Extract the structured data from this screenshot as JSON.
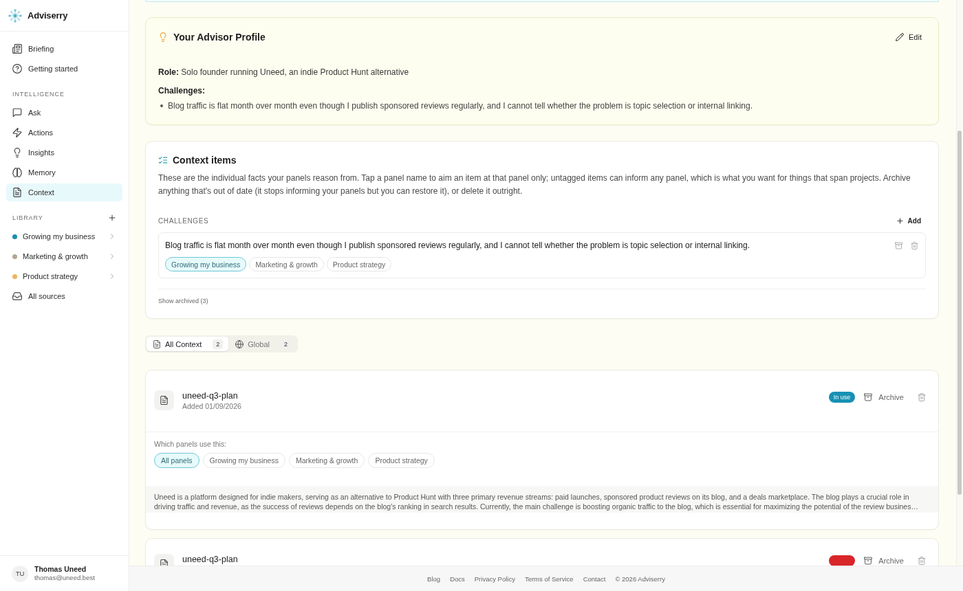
{
  "sidebar": {
    "brand": "Adviserry",
    "items": [
      {
        "kind": "page",
        "label": "Briefing",
        "selected": false
      },
      {
        "kind": "page",
        "label": "Getting started",
        "selected": false
      }
    ],
    "sections": [
      {
        "title": "INTELLIGENCE",
        "can_add": false,
        "items": [
          {
            "kind": "page",
            "label": "Ask",
            "selected": false
          },
          {
            "kind": "page",
            "label": "Actions",
            "selected": false
          },
          {
            "kind": "page",
            "label": "Insights",
            "selected": false
          },
          {
            "kind": "page",
            "label": "Memory",
            "selected": false
          },
          {
            "kind": "page",
            "label": "Context",
            "selected": true
          }
        ]
      },
      {
        "title": "LIBRARY",
        "can_add": true,
        "items": [
          {
            "kind": "panel",
            "label": "Growing my business",
            "color": "#1b8db0",
            "selected": false
          },
          {
            "kind": "panel",
            "label": "Marketing & growth",
            "color": "#b3a690",
            "selected": false
          },
          {
            "kind": "panel",
            "label": "Product strategy",
            "color": "#f2b15f",
            "selected": false
          },
          {
            "kind": "page",
            "label": "All sources",
            "selected": false
          }
        ]
      }
    ],
    "user": {
      "initials": "TU",
      "name": "Thomas Uneed",
      "email": "thomas@uneed.best"
    }
  },
  "profile": {
    "title": "Your Advisor Profile",
    "edit": "Edit",
    "role": "**Role:** Solo founder running Uneed, an indie Product Hunt alternative",
    "challenges_heading": "Challenges:",
    "challenges": [
      "Blog traffic is flat month over month even though I publish sponsored reviews regularly, and I cannot tell whether the problem is topic selection or internal linking."
    ]
  },
  "context_items": {
    "title": "Context items",
    "description": "These are the individual facts your panels reason from. Tap a panel name to aim an item at that panel only; untagged items can inform any panel, which is what you want for things that span projects. Archive anything that's out of date (it stops informing your panels but you can restore it), or delete it outright.",
    "groups": [
      {
        "title": "CHALLENGES",
        "add": "Add",
        "items": [
          {
            "text": "Blog traffic is flat month over month even though I publish sponsored reviews regularly, and I cannot tell whether the problem is topic selection or internal linking.",
            "tags": [
              {
                "label": "Growing my business",
                "selected": true
              },
              {
                "label": "Marketing & growth",
                "selected": false
              },
              {
                "label": "Product strategy",
                "selected": false
              }
            ]
          }
        ]
      }
    ],
    "show_archived": "Show archived (3)"
  },
  "tabs": [
    {
      "label": "All Context",
      "count": "2",
      "selected": true
    },
    {
      "label": "Global",
      "count": "2",
      "selected": false
    }
  ],
  "documents": [
    {
      "title": "uneed-q3-plan",
      "added": "Added 01/09/2026",
      "status": {
        "label": "In use",
        "color": "#1791b3"
      },
      "archive": "Archive",
      "panels_label": "Which panels use this:",
      "panels": [
        {
          "label": "All panels",
          "selected": true
        },
        {
          "label": "Growing my business",
          "selected": false
        },
        {
          "label": "Marketing & growth",
          "selected": false
        },
        {
          "label": "Product strategy",
          "selected": false
        }
      ],
      "summary": "Uneed is a platform designed for indie makers, serving as an alternative to Product Hunt with three primary revenue streams: paid launches, sponsored product reviews on its blog, and a deals marketplace. The blog plays a crucial role in driving traffic and revenue, as the success of reviews depends on the blog's ranking in search results. Currently, the main challenge is boosting organic traffic to the blog, which is essential for maximizing the potential of the review busines…"
    },
    {
      "title": "uneed-q3-plan",
      "status": {
        "color": "#d8262b"
      },
      "archive": "Archive"
    }
  ],
  "footer": {
    "links": [
      "Blog",
      "Docs",
      "Privacy Policy",
      "Terms of Service",
      "Contact"
    ],
    "copyright": "© 2026 Adviserry"
  }
}
